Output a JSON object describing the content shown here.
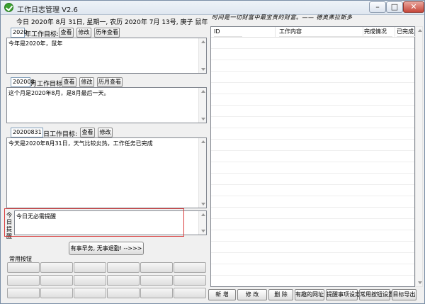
{
  "window": {
    "title": "工作日志管理 V2.6",
    "controls": {
      "minimize": "–",
      "maximize": "□",
      "close": "✕"
    }
  },
  "date_line": "今日 2020年 8月 31日, 星期一, 农历 2020年 7月 13号, 庚子 鼠年",
  "motto": "时间是一切财富中最宝贵的财富。—— 德奥弗拉斯多",
  "year_goal": {
    "year": "2020",
    "label": "年工作目标:",
    "view_btn": "查看",
    "edit_btn": "修改",
    "history_btn": "历年查看",
    "text": "今年是2020年，鼠年"
  },
  "month_goal": {
    "month": "202008",
    "label": "月工作目标:",
    "view_btn": "查看",
    "edit_btn": "修改",
    "history_btn": "历月查看",
    "text": "这个月是2020年8月，是8月最后一天。"
  },
  "day_goal": {
    "date": "20200831",
    "label": "日工作目标:",
    "view_btn": "查看",
    "edit_btn": "修改",
    "text": "今天是2020年8月31日，天气比较炎热，工作任务已完成"
  },
  "reminder": {
    "label": "今日提醒",
    "text": "今日无必需提醒"
  },
  "motto_button": "有事早务, 无事退勤! -->>>",
  "common_buttons": {
    "title": "常用按钮"
  },
  "table": {
    "columns": [
      "ID",
      "工作内容",
      "完成情况",
      "已完成"
    ]
  },
  "bottom_buttons": {
    "add": "新 增",
    "edit": "修 改",
    "delete": "删 除",
    "links": "有趣的网址",
    "reminder_settings": "提醒事项设定",
    "common_settings": "常用按钮设置",
    "export": "目标导出"
  }
}
